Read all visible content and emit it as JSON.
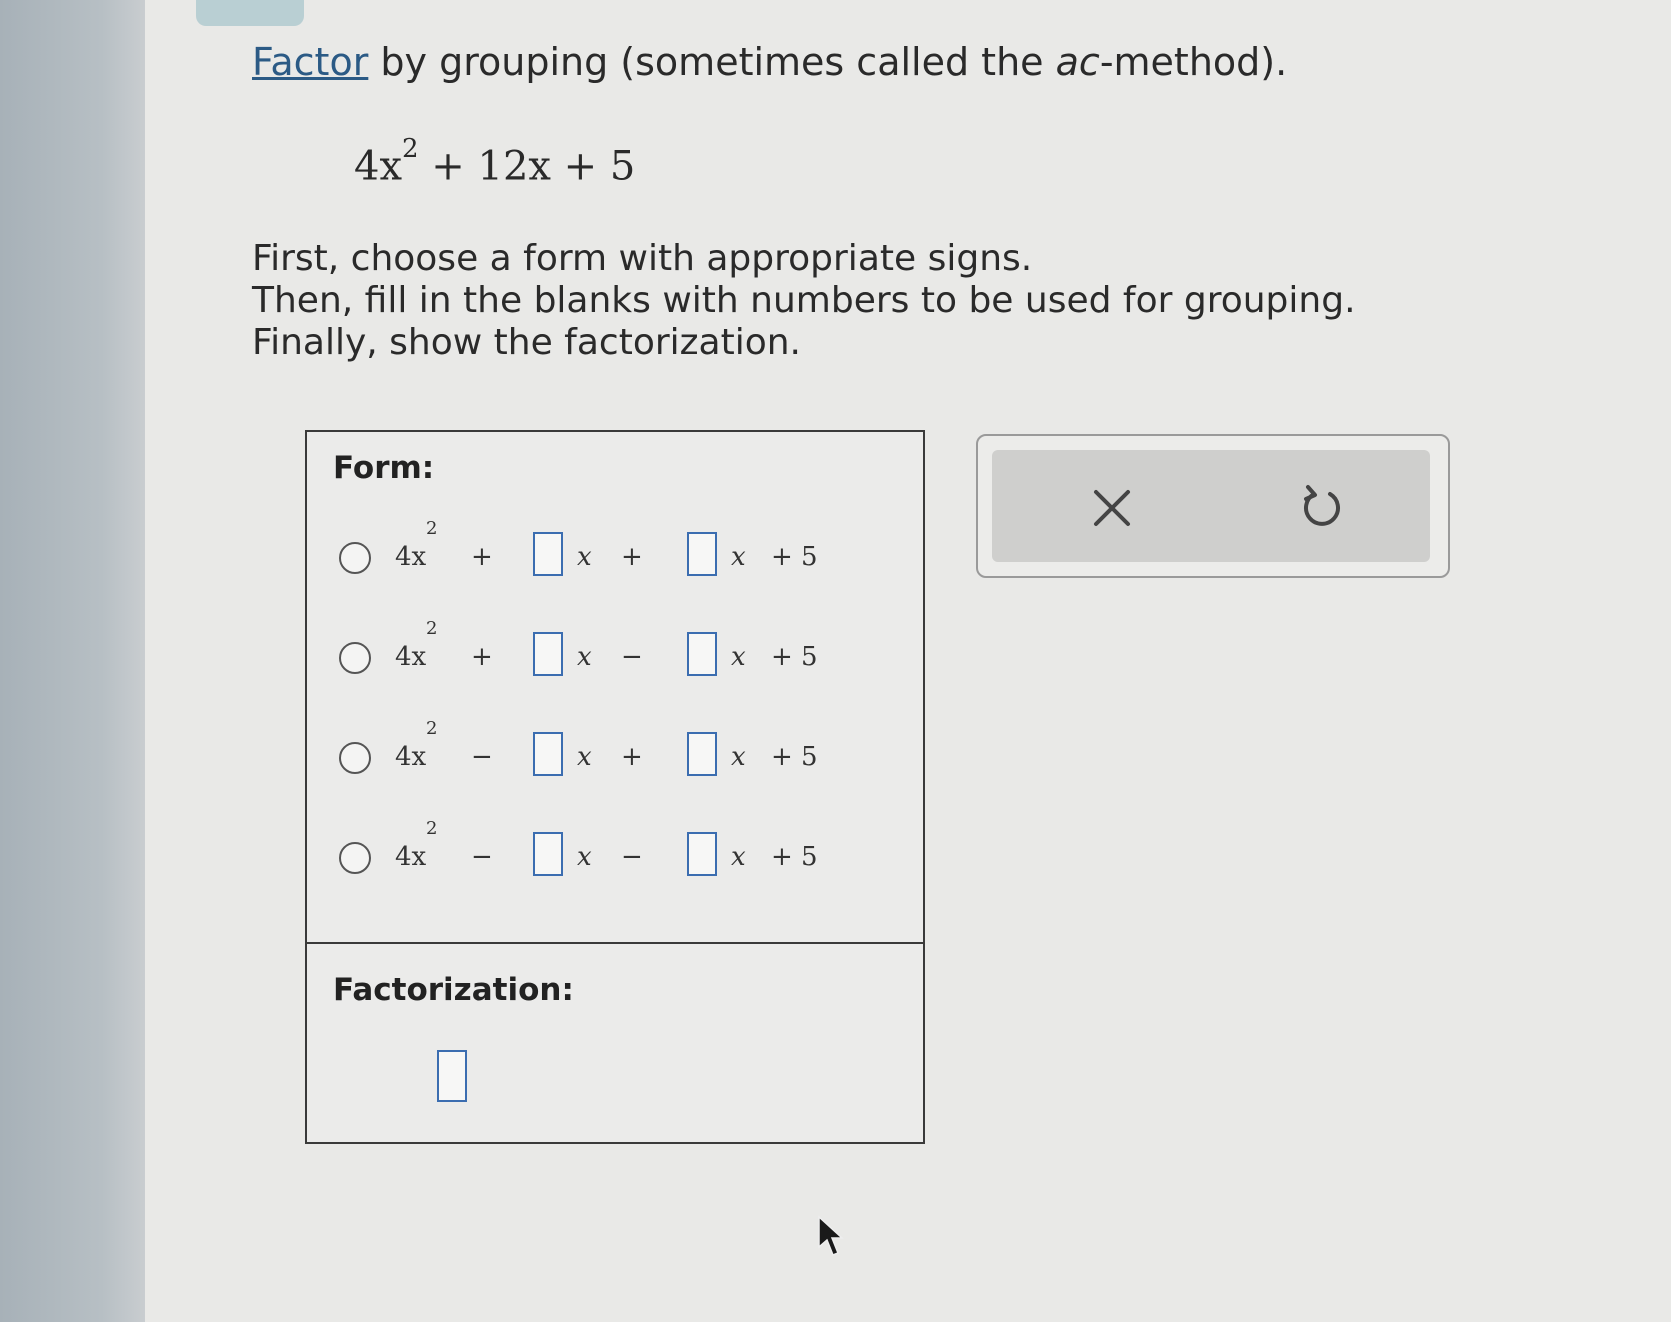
{
  "problem": {
    "title_link": "Factor",
    "title_rest_a": " by grouping (sometimes called the ",
    "title_italic": "ac",
    "title_rest_b": "-method).",
    "expression": {
      "coef_a": "4x",
      "exp": "2",
      "rest": " + 12x + 5"
    },
    "instructions": [
      "First, choose a form with appropriate signs.",
      "Then, fill in the blanks with numbers to be used for grouping.",
      "Finally, show the factorization."
    ]
  },
  "form_section": {
    "label": "Form:",
    "lead_term": "4x",
    "lead_exp": "2",
    "var": "x",
    "const": "+ 5",
    "options": [
      {
        "sign1": "+",
        "sign2": "+"
      },
      {
        "sign1": "+",
        "sign2": "−"
      },
      {
        "sign1": "−",
        "sign2": "+"
      },
      {
        "sign1": "−",
        "sign2": "−"
      }
    ]
  },
  "factorization_section": {
    "label": "Factorization:"
  },
  "tools": {
    "clear_icon": "close-icon",
    "undo_icon": "undo-icon"
  },
  "colors": {
    "link": "#2b5a85",
    "blank_border": "#3b6db0"
  }
}
